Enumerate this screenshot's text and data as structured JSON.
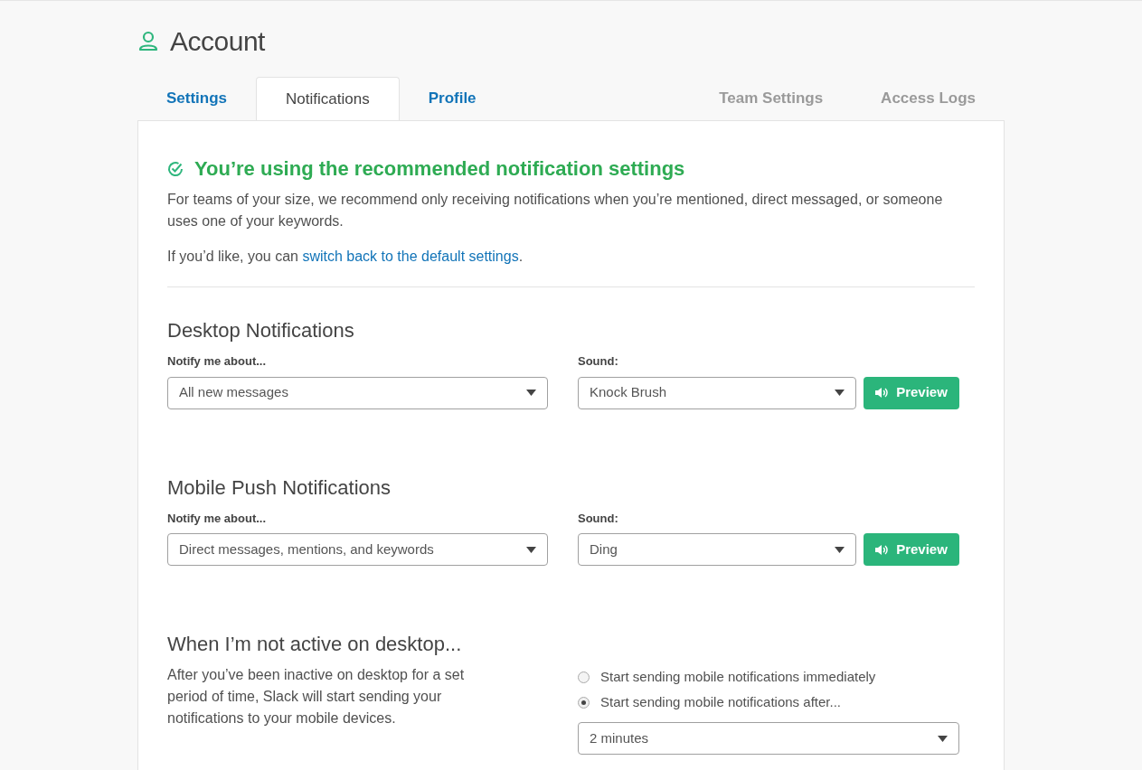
{
  "header": {
    "title": "Account"
  },
  "tabs": [
    {
      "label": "Settings",
      "selected": false,
      "disabled": false
    },
    {
      "label": "Notifications",
      "selected": true,
      "disabled": false
    },
    {
      "label": "Profile",
      "selected": false,
      "disabled": false
    },
    {
      "label": "Team Settings",
      "selected": false,
      "disabled": true
    },
    {
      "label": "Access Logs",
      "selected": false,
      "disabled": true
    }
  ],
  "banner": {
    "title": "You’re using the recommended notification settings",
    "body": "For teams of your size, we recommend only receiving notifications when you’re mentioned, direct messaged, or someone uses one of your keywords.",
    "link_prefix": "If you’d like, you can",
    "link": "switch back to the default settings",
    "link_suffix": "."
  },
  "sections": [
    {
      "title": "Desktop Notifications",
      "notify_label": "Notify me about...",
      "notify_value": "All new messages",
      "sound_label": "Sound:",
      "sound_value": "Knock Brush",
      "preview_button": "Preview"
    },
    {
      "title": "Mobile Push Notifications",
      "notify_label": "Notify me about...",
      "notify_value": "Direct messages, mentions, and keywords",
      "sound_label": "Sound:",
      "sound_value": "Ding",
      "preview_button": "Preview"
    }
  ],
  "inactive": {
    "title": "When I’m not active on desktop...",
    "description": "After you’ve been inactive on desktop for a set period of time, Slack will start sending your notifications to your mobile devices.",
    "options": [
      {
        "label": "Start sending mobile notifications immediately",
        "selected": false
      },
      {
        "label": "Start sending mobile notifications after...",
        "selected": true
      }
    ],
    "delay_value": "2 minutes"
  }
}
